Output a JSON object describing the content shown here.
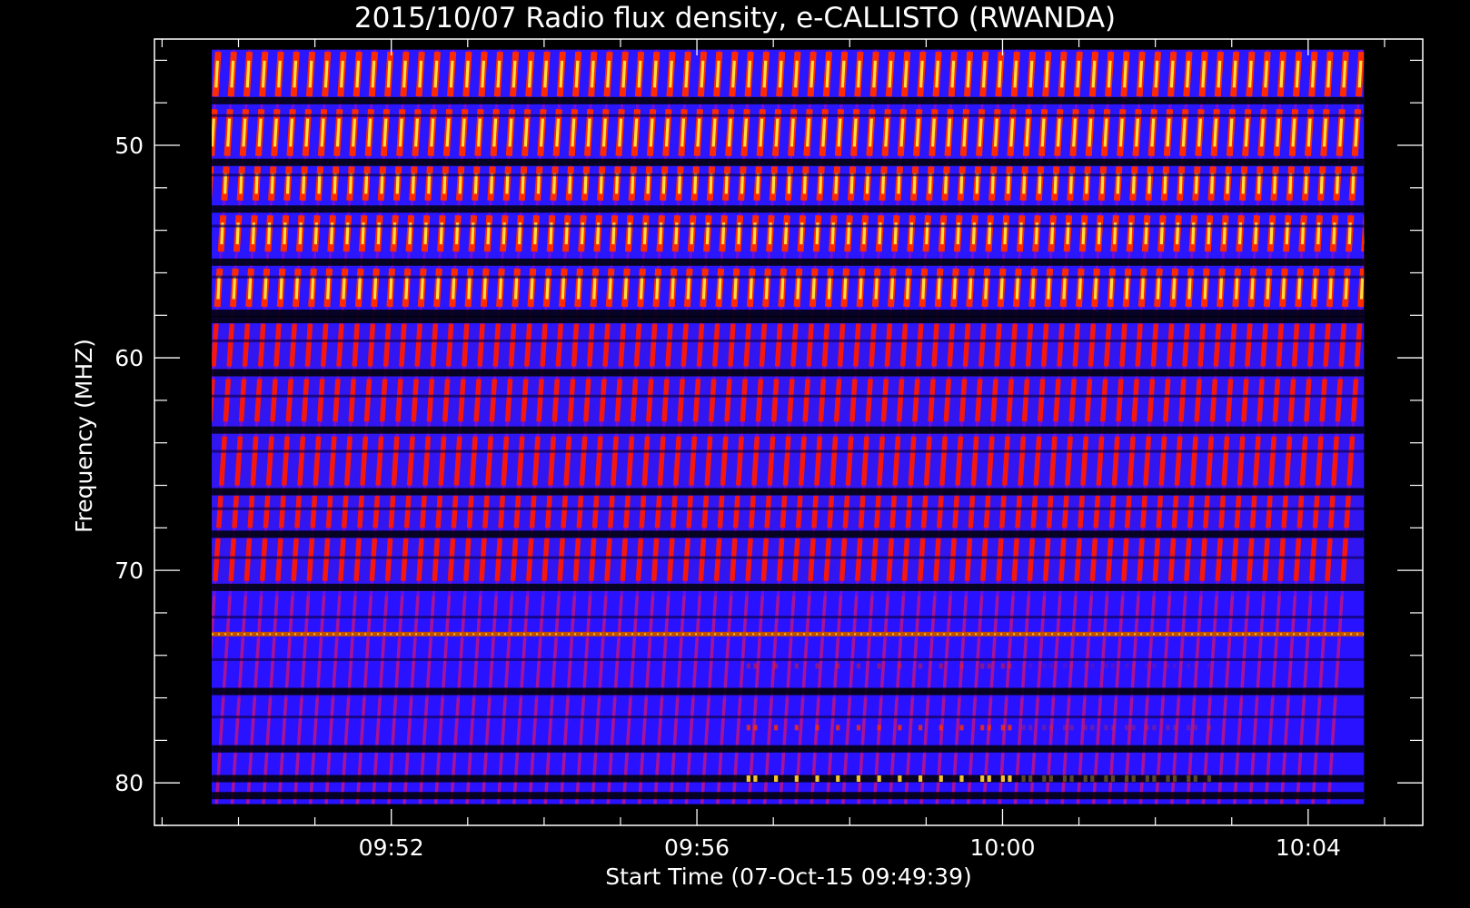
{
  "chart_data": {
    "type": "heatmap",
    "title": "2015/10/07  Radio flux density, e-CALLISTO (RWANDA)",
    "xlabel": "Start Time (07-Oct-15 09:49:39)",
    "ylabel": "Frequency (MHZ)",
    "x_ticks": [
      "09:52",
      "09:56",
      "10:00",
      "10:04"
    ],
    "y_ticks": [
      "50",
      "60",
      "70",
      "80"
    ],
    "x_tick_minutes": [
      2.35,
      6.35,
      10.35,
      14.35
    ],
    "xlim_minutes": [
      -0.75,
      15.85
    ],
    "ylim_mhz": [
      45,
      82
    ],
    "data_extent": {
      "t_start_min": 0,
      "t_end_min": 15.08,
      "f_min_mhz": 45.5,
      "f_max_mhz": 81
    },
    "y_inverted": true,
    "colormap": [
      "#000000",
      "#1a00b0",
      "#2a16ff",
      "#8000d0",
      "#ff1000",
      "#ff8000",
      "#ffff40"
    ],
    "colors": {
      "background": "#000000",
      "axes": "#ffffff",
      "text": "#ffffff"
    },
    "features": {
      "stripe_period_min": 0.205,
      "stripe_drift_min_per_mhz": 0.018,
      "bright_bands_mhz": [
        [
          45.5,
          58.5
        ]
      ],
      "medium_bands_mhz": [
        [
          58.5,
          71
        ]
      ],
      "narrowband_interference_mhz": 73,
      "burst_region": {
        "t_min": [
          7,
          10.5
        ],
        "f_mhz": [
          74,
          80
        ]
      }
    }
  }
}
